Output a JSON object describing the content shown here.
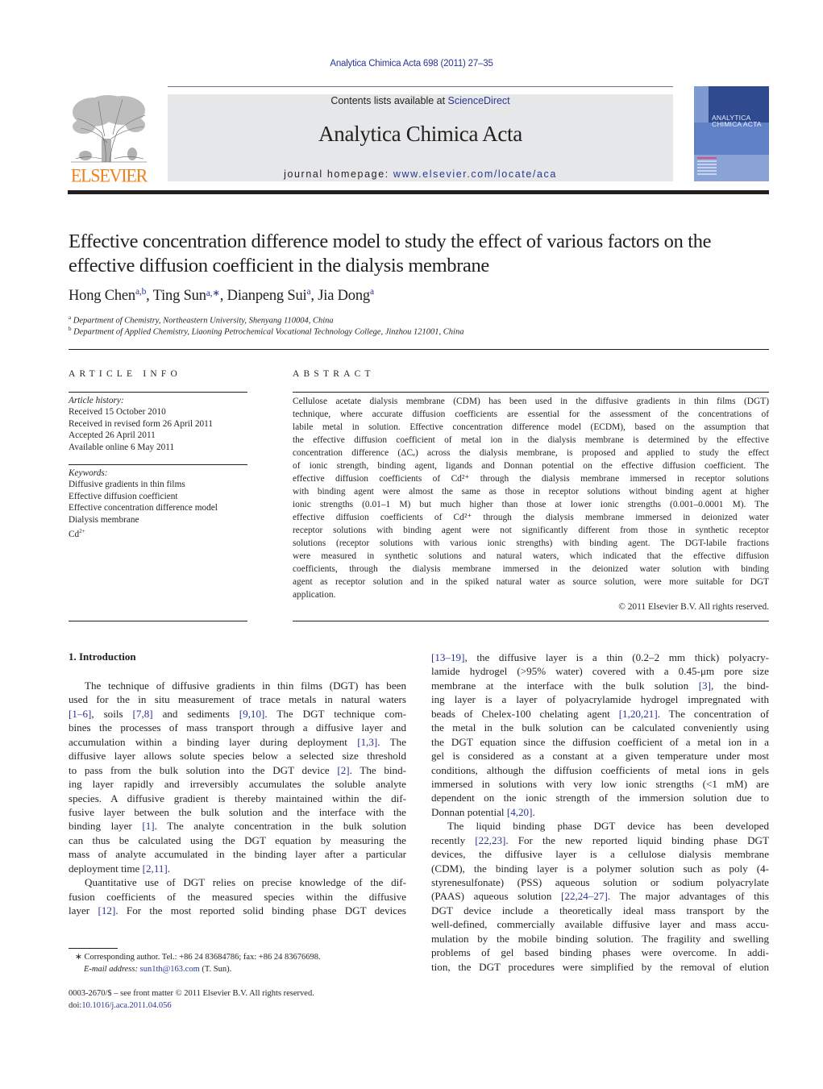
{
  "header": {
    "journal_ref": "Analytica Chimica Acta 698 (2011) 27–35",
    "contents_prefix": "Contents lists available at ",
    "contents_link": "ScienceDirect",
    "journal_title": "Analytica Chimica Acta",
    "homepage_prefix": "journal homepage: ",
    "homepage_link": "www.elsevier.com/locate/aca",
    "publisher_logo_text": "ELSEVIER",
    "cover_title_line1": "ANALYTICA",
    "cover_title_line2": "CHIMICA ACTA",
    "colors": {
      "link": "#2a3694",
      "elsevier_orange": "#f07f1a",
      "masthead_bg": "#e6e7e8"
    }
  },
  "article": {
    "title": "Effective concentration difference model to study the effect of various factors on the effective diffusion coefficient in the dialysis membrane",
    "authors": [
      {
        "name": "Hong Chen",
        "sup": "a,b"
      },
      {
        "name": "Ting Sun",
        "sup": "a,∗"
      },
      {
        "name": "Dianpeng Sui",
        "sup": "a"
      },
      {
        "name": "Jia Dong",
        "sup": "a"
      }
    ],
    "affiliations": [
      {
        "mark": "a",
        "text": "Department of Chemistry, Northeastern University, Shenyang 110004, China"
      },
      {
        "mark": "b",
        "text": "Department of Applied Chemistry, Liaoning Petrochemical Vocational Technology College, Jinzhou 121001, China"
      }
    ]
  },
  "article_info": {
    "heading": "ARTICLE INFO",
    "history_label": "Article history:",
    "history": [
      "Received 15 October 2010",
      "Received in revised form 26 April 2011",
      "Accepted 26 April 2011",
      "Available online 6 May 2011"
    ],
    "keywords_label": "Keywords:",
    "keywords": [
      "Diffusive gradients in thin films",
      "Effective diffusion coefficient",
      "Effective concentration difference model",
      "Dialysis membrane",
      "Cd"
    ],
    "keyword_last_sup": "2+"
  },
  "abstract": {
    "heading": "ABSTRACT",
    "lines": [
      "Cellulose acetate dialysis membrane (CDM) has been used in the diffusive gradients in thin films (DGT)",
      "technique, where accurate diffusion coefficients are essential for the assessment of the concentrations of",
      "labile metal in solution. Effective concentration difference model (ECDM), based on the assumption that",
      "the effective diffusion coefficient of metal ion in the dialysis membrane is determined by the effective",
      "concentration difference (ΔCₑ) across the dialysis membrane, is proposed and applied to study the effect",
      "of ionic strength, binding agent, ligands and Donnan potential on the effective diffusion coefficient. The",
      "effective diffusion coefficients of Cd²⁺ through the dialysis membrane immersed in receptor solutions",
      "with binding agent were almost the same as those in receptor solutions without binding agent at higher",
      "ionic strengths (0.01–1 M) but much higher than those at lower ionic strengths (0.001–0.0001 M). The",
      "effective diffusion coefficients of Cd²⁺ through the dialysis membrane immersed in deionized water",
      "receptor solutions with binding agent were not significantly different from those in synthetic receptor",
      "solutions (receptor solutions with various ionic strengths) with binding agent. The DGT-labile fractions",
      "were measured in synthetic solutions and natural waters, which indicated that the effective diffusion",
      "coefficients, through the dialysis membrane immersed in the deionized water solution with binding",
      "agent as receptor solution and in the spiked natural water as source solution, were more suitable for DGT",
      "application."
    ],
    "copyright": "© 2011 Elsevier B.V. All rights reserved."
  },
  "introduction": {
    "heading": "1.  Introduction",
    "left_lines": [
      [
        {
          "t": "The technique of diffusive gradients in thin films (DGT) has been"
        }
      ],
      [
        {
          "t": "used for the in situ measurement of trace metals in natural waters"
        }
      ],
      [
        {
          "c": "[1–6]"
        },
        {
          "t": ", soils "
        },
        {
          "c": "[7,8]"
        },
        {
          "t": " and sediments "
        },
        {
          "c": "[9,10]"
        },
        {
          "t": ". The DGT technique com-"
        }
      ],
      [
        {
          "t": "bines the processes of mass transport through a diffusive layer and"
        }
      ],
      [
        {
          "t": "accumulation within a binding layer during deployment "
        },
        {
          "c": "[1,3]"
        },
        {
          "t": ". The"
        }
      ],
      [
        {
          "t": "diffusive layer allows solute species below a selected size threshold"
        }
      ],
      [
        {
          "t": "to pass from the bulk solution into the DGT device "
        },
        {
          "c": "[2]"
        },
        {
          "t": ". The bind-"
        }
      ],
      [
        {
          "t": "ing layer rapidly and irreversibly accumulates the soluble analyte"
        }
      ],
      [
        {
          "t": "species. A diffusive gradient is thereby maintained within the dif-"
        }
      ],
      [
        {
          "t": "fusive layer between the bulk solution and the interface with the"
        }
      ],
      [
        {
          "t": "binding layer "
        },
        {
          "c": "[1]"
        },
        {
          "t": ". The analyte concentration in the bulk solution"
        }
      ],
      [
        {
          "t": "can thus be calculated using the DGT equation by measuring the"
        }
      ],
      [
        {
          "t": "mass of analyte accumulated in the binding layer after a particular"
        }
      ],
      [
        {
          "t": "deployment time "
        },
        {
          "c": "[2,11]"
        },
        {
          "t": "."
        }
      ],
      [
        {
          "t": "Quantitative use of DGT relies on precise knowledge of the dif-"
        }
      ],
      [
        {
          "t": "fusion coefficients of the measured species within the diffusive"
        }
      ],
      [
        {
          "t": "layer "
        },
        {
          "c": "[12]"
        },
        {
          "t": ". For the most reported solid binding phase DGT devices"
        }
      ]
    ],
    "right_lines": [
      [
        {
          "c": "[13–19]"
        },
        {
          "t": ", the diffusive layer is a thin (0.2–2 mm thick) polyacry-"
        }
      ],
      [
        {
          "t": "lamide hydrogel (>95% water) covered with a 0.45-μm pore size"
        }
      ],
      [
        {
          "t": "membrane at the interface with the bulk solution "
        },
        {
          "c": "[3]"
        },
        {
          "t": ", the bind-"
        }
      ],
      [
        {
          "t": "ing layer is a layer of polyacrylamide hydrogel impregnated with"
        }
      ],
      [
        {
          "t": "beads of Chelex-100 chelating agent "
        },
        {
          "c": "[1,20,21]"
        },
        {
          "t": ". The concentration of"
        }
      ],
      [
        {
          "t": "the metal in the bulk solution can be calculated conveniently using"
        }
      ],
      [
        {
          "t": "the DGT equation since the diffusion coefficient of a metal ion in a"
        }
      ],
      [
        {
          "t": "gel is considered as a constant at a given temperature under most"
        }
      ],
      [
        {
          "t": "conditions, although the diffusion coefficients of metal ions in gels"
        }
      ],
      [
        {
          "t": "immersed in solutions with very low ionic strengths (<1 mM) are"
        }
      ],
      [
        {
          "t": "dependent on the ionic strength of the immersion solution due to"
        }
      ],
      [
        {
          "t": "Donnan potential "
        },
        {
          "c": "[4,20]"
        },
        {
          "t": "."
        }
      ],
      [
        {
          "t": "The liquid binding phase DGT device has been developed"
        }
      ],
      [
        {
          "t": "recently "
        },
        {
          "c": "[22,23]"
        },
        {
          "t": ". For the new reported liquid binding phase DGT"
        }
      ],
      [
        {
          "t": "devices, the diffusive layer is a cellulose dialysis membrane"
        }
      ],
      [
        {
          "t": "(CDM), the binding layer is a polymer solution such as poly (4-"
        }
      ],
      [
        {
          "t": "styrenesulfonate) (PSS) aqueous solution or sodium polyacrylate"
        }
      ],
      [
        {
          "t": "(PAAS) aqueous solution "
        },
        {
          "c": "[22,24–27]"
        },
        {
          "t": ". The major advantages of this"
        }
      ],
      [
        {
          "t": "DGT device include a theoretically ideal mass transport by the"
        }
      ],
      [
        {
          "t": "well-defined, commercially available diffusive layer and mass accu-"
        }
      ],
      [
        {
          "t": "mulation by the mobile binding solution. The fragility and swelling"
        }
      ],
      [
        {
          "t": "problems of gel based binding phases were overcome. In addi-"
        }
      ],
      [
        {
          "t": "tion, the DGT procedures were simplified by the removal of elution"
        }
      ]
    ],
    "left_indent_lines": [
      0,
      14
    ],
    "left_last_lines": [
      13
    ],
    "right_indent_lines": [
      12
    ],
    "right_last_lines": [
      11
    ]
  },
  "footnote": {
    "marker": "∗",
    "corresponding": "Corresponding author. Tel.: +86 24 83684786; fax: +86 24 83676698.",
    "email_label": "E-mail address:",
    "email": "sun1th@163.com",
    "email_suffix": " (T. Sun)."
  },
  "front_matter": {
    "issn_line": "0003-2670/$ – see front matter © 2011 Elsevier B.V. All rights reserved.",
    "doi_prefix": "doi:",
    "doi": "10.1016/j.aca.2011.04.056"
  }
}
